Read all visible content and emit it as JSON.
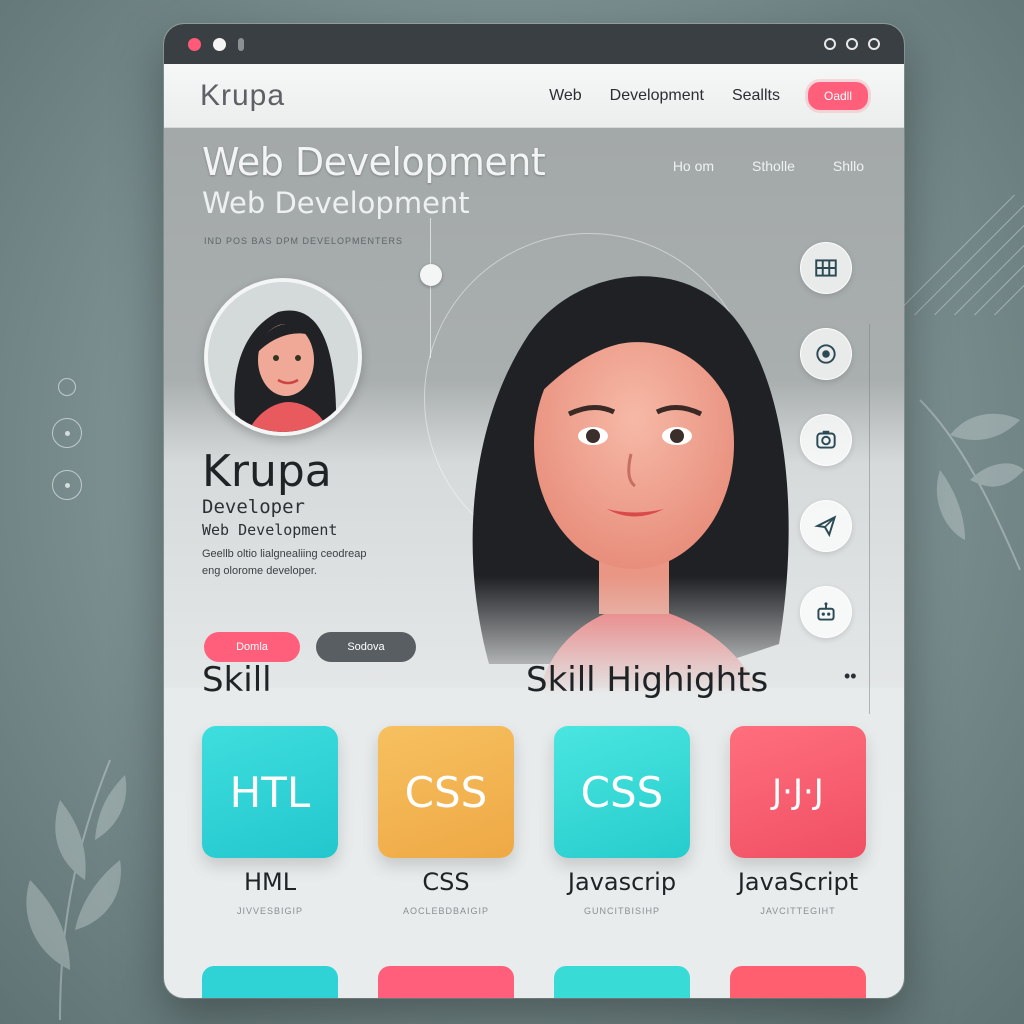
{
  "window": {
    "brand": "Krupa",
    "nav": [
      "Web",
      "Development",
      "Seallts"
    ],
    "nav_button": "Oadll"
  },
  "hero": {
    "title": "Web Development",
    "subtitle": "Web Development",
    "small_text": "IND POS BAS DPM DEVELOPMENTERS",
    "links": [
      "Ho om",
      "Stholle",
      "Shllo"
    ]
  },
  "profile": {
    "name": "Krupa",
    "role": "Developer",
    "field": "Web Development",
    "description": "Geellb oltio lialgnealiing ceodreap eng olorome developer.",
    "primary_button": "Domla",
    "secondary_button": "Sodova"
  },
  "side_icons": [
    "grid-icon",
    "record-icon",
    "camera-icon",
    "send-icon",
    "robot-icon"
  ],
  "skills": {
    "heading": "Skill",
    "title": "Skill Highights",
    "more": "••",
    "cards": [
      {
        "text": "HTL",
        "label": "HML",
        "sub": "JIVVESBIGIP",
        "color": "#2fd3d6"
      },
      {
        "text": "CSS",
        "label": "CSS",
        "sub": "AOCLEBDBAIGIP",
        "color": "#f4b552"
      },
      {
        "text": "CSS",
        "label": "Javascrip",
        "sub": "GUNCITBISIHP",
        "color": "#39dbd6"
      },
      {
        "text": "J·J·J",
        "label": "JavaScript",
        "sub": "JAVCITTEGIHT",
        "color": "#ff5f6f"
      }
    ],
    "row2_colors": [
      "#2fd3d6",
      "#ff5f7a",
      "#39dbd6",
      "#ff5f6f"
    ]
  },
  "colors": {
    "accent": "#ff5f7a",
    "titlebar": "#3a3f43"
  }
}
